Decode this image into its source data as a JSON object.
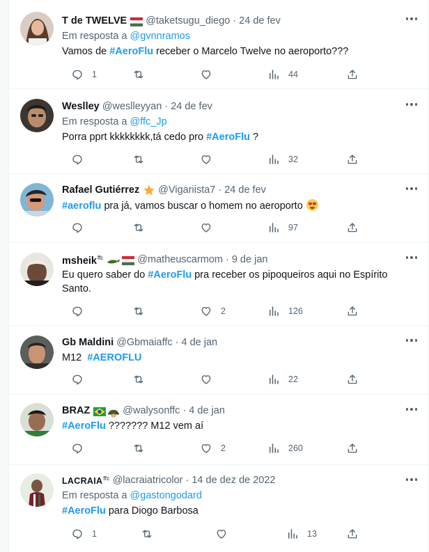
{
  "tweets": [
    {
      "name": "T de TWELVE",
      "handle": "@taketsugu_diego",
      "date": "24 de fev",
      "reply_prefix": "Em resposta a",
      "reply_to": "@gvnnramos",
      "text_before": "Vamos de ",
      "hashtag": "#AeroFlu",
      "text_after": " receber o Marcelo Twelve no aeroporto???",
      "replies": "1",
      "retweets": "",
      "likes": "",
      "views": "44"
    },
    {
      "name": "Weslley",
      "handle": "@weslleyyan",
      "date": "24 de fev",
      "reply_prefix": "Em resposta a",
      "reply_to": "@ffc_Jp",
      "text_before": "Porra pprt kkkkkkkk,tá cedo pro ",
      "hashtag": "#AeroFlu",
      "text_after": " ?",
      "replies": "",
      "retweets": "",
      "likes": "",
      "views": "32"
    },
    {
      "name": "Rafael Gutiérrez",
      "handle": "@Vigariista7",
      "date": "24 de fev",
      "text_before": "",
      "hashtag": "#aeroflu",
      "text_after": " pra já, vamos buscar o homem no aeroporto",
      "replies": "",
      "retweets": "",
      "likes": "",
      "views": "97"
    },
    {
      "name": "msheik",
      "name_sup": "ffc",
      "handle": "@matheuscarmom",
      "date": "9 de jan",
      "text_before": "Eu quero saber do ",
      "hashtag": "#AeroFlu",
      "text_after": " pra receber os pipoqueiros aqui no Espírito",
      "text_line2": "Santo.",
      "replies": "",
      "retweets": "",
      "likes": "2",
      "views": "126"
    },
    {
      "name": "Gb Maldini",
      "handle": "@Gbmaiaffc",
      "date": "4 de jan",
      "text_before": "M12  ",
      "hashtag": "#AEROFLU",
      "text_after": "",
      "replies": "",
      "retweets": "",
      "likes": "",
      "views": "22"
    },
    {
      "name": "BRAZ",
      "handle": "@walysonffc",
      "date": "4 de jan",
      "text_before": "",
      "hashtag": "#AeroFlu",
      "text_after": " ??????? M12 vem aí",
      "replies": "",
      "retweets": "",
      "likes": "2",
      "views": "260"
    },
    {
      "name": "LACRAIA",
      "name_sup": "ffc",
      "handle": "@lacraiatricolor",
      "date": "14 de dez de 2022",
      "reply_prefix": "Em resposta a",
      "reply_to": "@gastongodard",
      "text_before": "",
      "hashtag": "#AeroFlu",
      "text_after": " para Diogo Barbosa",
      "replies": "1",
      "retweets": "",
      "likes": "",
      "views": "13"
    }
  ]
}
